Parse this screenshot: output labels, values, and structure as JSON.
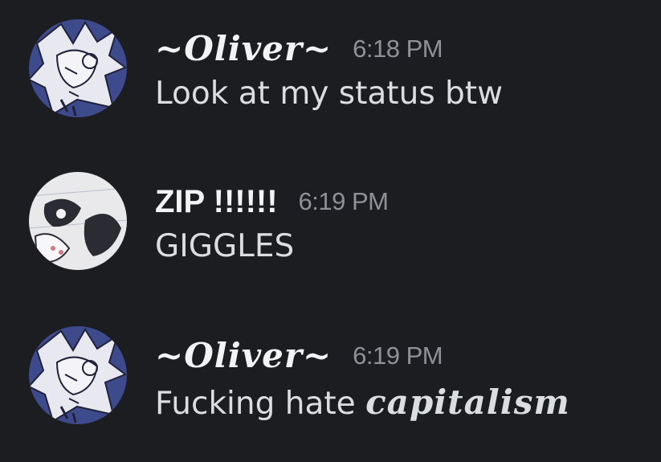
{
  "messages": [
    {
      "username": "~Oliver~",
      "timestamp": "6:18 PM",
      "text": "Look at my status btw",
      "avatar": "avatar-oliver"
    },
    {
      "username": "ZIP !!!!!!",
      "timestamp": "6:19 PM",
      "text": "GIGGLES",
      "avatar": "avatar-zip"
    },
    {
      "username": "~Oliver~",
      "timestamp": "6:19 PM",
      "text_plain": "Fucking hate ",
      "text_styled": "capitalism",
      "avatar": "avatar-oliver"
    }
  ],
  "colors": {
    "background": "#1c1d21",
    "username": "#f2f3f5",
    "timestamp": "#8e9196",
    "message_text": "#dbdee1",
    "oliver_avatar_bg": "#3d4a8c",
    "zip_avatar_bg": "#e9e9ec"
  }
}
